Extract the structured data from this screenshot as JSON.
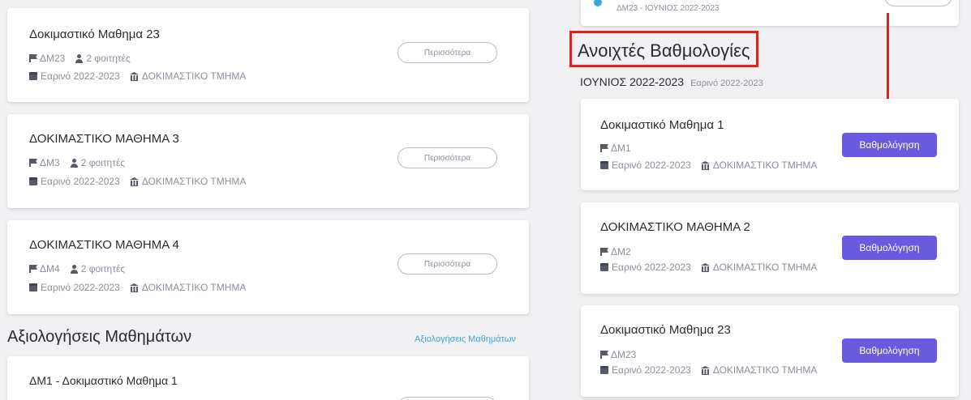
{
  "left_courses": [
    {
      "title": "Δοκιμαστικό Μαθημα 23",
      "code": "ΔΜ23",
      "students": "2 φοιτητές",
      "semester": "Εαρινό 2022-2023",
      "department": "ΔΟΚΙΜΑΣΤΙΚΟ ΤΜΗΜΑ",
      "button": "Περισσότερα"
    },
    {
      "title": "ΔΟΚΙΜΑΣΤΙΚΟ ΜΑΘΗΜΑ 3",
      "code": "ΔΜ3",
      "students": "2 φοιτητές",
      "semester": "Εαρινό 2022-2023",
      "department": "ΔΟΚΙΜΑΣΤΙΚΟ ΤΜΗΜΑ",
      "button": "Περισσότερα"
    },
    {
      "title": "ΔΟΚΙΜΑΣΤΙΚΟ ΜΑΘΗΜΑ 4",
      "code": "ΔΜ4",
      "students": "2 φοιτητές",
      "semester": "Εαρινό 2022-2023",
      "department": "ΔΟΚΙΜΑΣΤΙΚΟ ΤΜΗΜΑ",
      "button": "Περισσότερα"
    }
  ],
  "evaluations": {
    "title": "Αξιολογήσεις Μαθημάτων",
    "link": "Αξιολογήσεις Μαθημάτων",
    "first_item": "ΔΜ1 - Δοκιμαστικό Μαθημα 1"
  },
  "top_partial_card": {
    "subtitle": "ΔΜ23 - ΙΟΥΝΙΟΣ 2022-2023"
  },
  "open_grades": {
    "title": "Ανοιχτές Βαθμολογίες",
    "period": "ΙΟΥΝΙΟΣ 2022-2023",
    "period_semester": "Εαρινό 2022-2023",
    "items": [
      {
        "title": "Δοκιμαστικό Μαθημα 1",
        "code": "ΔΜ1",
        "semester": "Εαρινό 2022-2023",
        "department": "ΔΟΚΙΜΑΣΤΙΚΟ ΤΜΗΜΑ",
        "button": "Βαθμολόγηση"
      },
      {
        "title": "ΔΟΚΙΜΑΣΤΙΚΟ ΜΑΘΗΜΑ 2",
        "code": "ΔΜ2",
        "semester": "Εαρινό 2022-2023",
        "department": "ΔΟΚΙΜΑΣΤΙΚΟ ΤΜΗΜΑ",
        "button": "Βαθμολόγηση"
      },
      {
        "title": "Δοκιμαστικό Μαθημα 23",
        "code": "ΔΜ23",
        "semester": "Εαρινό 2022-2023",
        "department": "ΔΟΚΙΜΑΣΤΙΚΟ ΤΜΗΜΑ",
        "button": "Βαθμολόγηση"
      }
    ]
  },
  "colors": {
    "primary": "#6a5ae0",
    "link": "#3aa7d9",
    "annotation": "#e0201e",
    "background": "#f1f1f4"
  }
}
